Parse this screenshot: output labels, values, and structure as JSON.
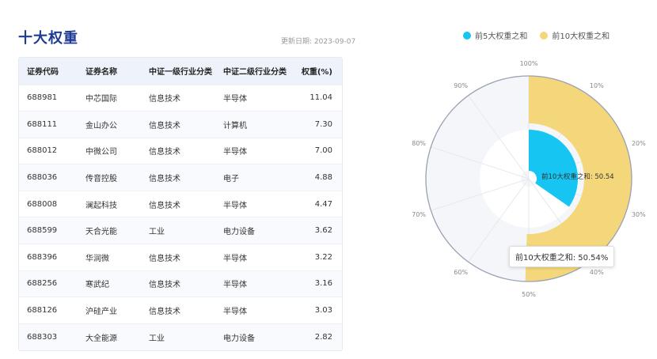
{
  "page": {
    "title": "十大权重",
    "update_date": "更新日期: 2023-09-07"
  },
  "table": {
    "headers": [
      "证券代码",
      "证券名称",
      "中证一级行业分类",
      "中证二级行业分类",
      "权重(%)"
    ],
    "rows": [
      [
        "688981",
        "中芯国际",
        "信息技术",
        "半导体",
        "11.04"
      ],
      [
        "688111",
        "金山办公",
        "信息技术",
        "计算机",
        "7.30"
      ],
      [
        "688012",
        "中微公司",
        "信息技术",
        "半导体",
        "7.00"
      ],
      [
        "688036",
        "传音控股",
        "信息技术",
        "电子",
        "4.88"
      ],
      [
        "688008",
        "澜起科技",
        "信息技术",
        "半导体",
        "4.47"
      ],
      [
        "688599",
        "天合光能",
        "工业",
        "电力设备",
        "3.62"
      ],
      [
        "688396",
        "华润微",
        "信息技术",
        "半导体",
        "3.22"
      ],
      [
        "688256",
        "寒武纪",
        "信息技术",
        "半导体",
        "3.16"
      ],
      [
        "688126",
        "沪硅产业",
        "信息技术",
        "半导体",
        "3.03"
      ],
      [
        "688303",
        "大全能源",
        "工业",
        "电力设备",
        "2.82"
      ]
    ]
  },
  "legend": [
    {
      "label": "前5大权重之和",
      "color": "#16c5f2"
    },
    {
      "label": "前10大权重之和",
      "color": "#f5d77b"
    }
  ],
  "chart_data": {
    "type": "polar-bar",
    "angle_ticks": [
      "100%",
      "10%",
      "20%",
      "30%",
      "40%",
      "50%",
      "60%",
      "70%",
      "80%",
      "90%"
    ],
    "series": [
      {
        "name": "前5大权重之和",
        "value": 34.69,
        "color": "#16c5f2"
      },
      {
        "name": "前10大权重之和",
        "value": 50.54,
        "color": "#f5d77b"
      }
    ],
    "center_label": "前10大权重之和: 50.54",
    "angle_max": 100
  },
  "tooltip": {
    "text": "前10大权重之和: 50.54%"
  }
}
